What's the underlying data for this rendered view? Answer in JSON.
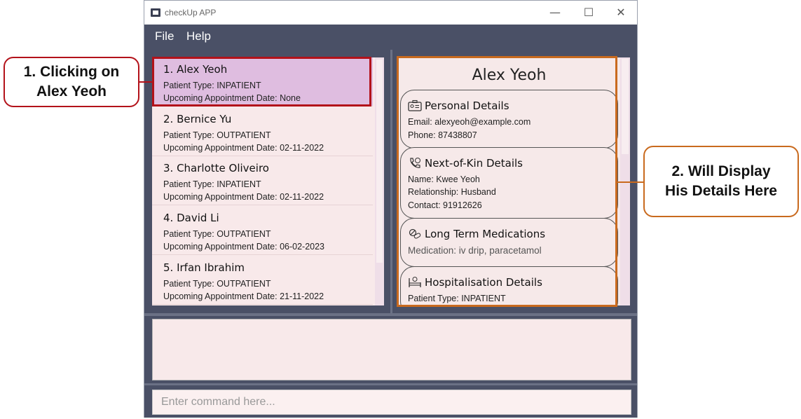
{
  "window": {
    "title": "checkUp APP",
    "controls": {
      "minimize": "—",
      "maximize": "☐",
      "close": "✕"
    }
  },
  "menu": {
    "file": "File",
    "help": "Help"
  },
  "patients": [
    {
      "name": "1.  Alex Yeoh",
      "type": "Patient Type: INPATIENT",
      "appointment": "Upcoming Appointment Date: None"
    },
    {
      "name": "2.  Bernice Yu",
      "type": "Patient Type: OUTPATIENT",
      "appointment": "Upcoming Appointment Date: 02-11-2022"
    },
    {
      "name": "3.  Charlotte Oliveiro",
      "type": "Patient Type: INPATIENT",
      "appointment": "Upcoming Appointment Date: 02-11-2022"
    },
    {
      "name": "4.  David Li",
      "type": "Patient Type: OUTPATIENT",
      "appointment": "Upcoming Appointment Date: 06-02-2023"
    },
    {
      "name": "5.  Irfan Ibrahim",
      "type": "Patient Type: OUTPATIENT",
      "appointment": "Upcoming Appointment Date: 21-11-2022"
    }
  ],
  "details": {
    "name": "Alex Yeoh",
    "personal": {
      "title": "Personal Details",
      "icon": "id-card-icon",
      "email": "Email: alexyeoh@example.com",
      "phone": "Phone: 87438807"
    },
    "nok": {
      "title": "Next-of-Kin Details",
      "icon": "phone-icon",
      "name": "Name: Kwee Yeoh",
      "relationship": "Relationship: Husband",
      "contact": "Contact: 91912626"
    },
    "medications": {
      "title": "Long Term Medications",
      "icon": "pills-icon",
      "medication": "Medication: iv drip, paracetamol"
    },
    "hospitalisation": {
      "title": "Hospitalisation Details",
      "icon": "hospital-bed-icon",
      "type": "Patient Type: INPATIENT"
    }
  },
  "command": {
    "placeholder": "Enter command here..."
  },
  "annotations": {
    "left": {
      "line1": "1. Clicking on",
      "line2": "Alex Yeoh",
      "color": "#b3121a"
    },
    "right": {
      "line1": "2. Will Display",
      "line2": "His Details Here",
      "color": "#c96a1e"
    }
  }
}
